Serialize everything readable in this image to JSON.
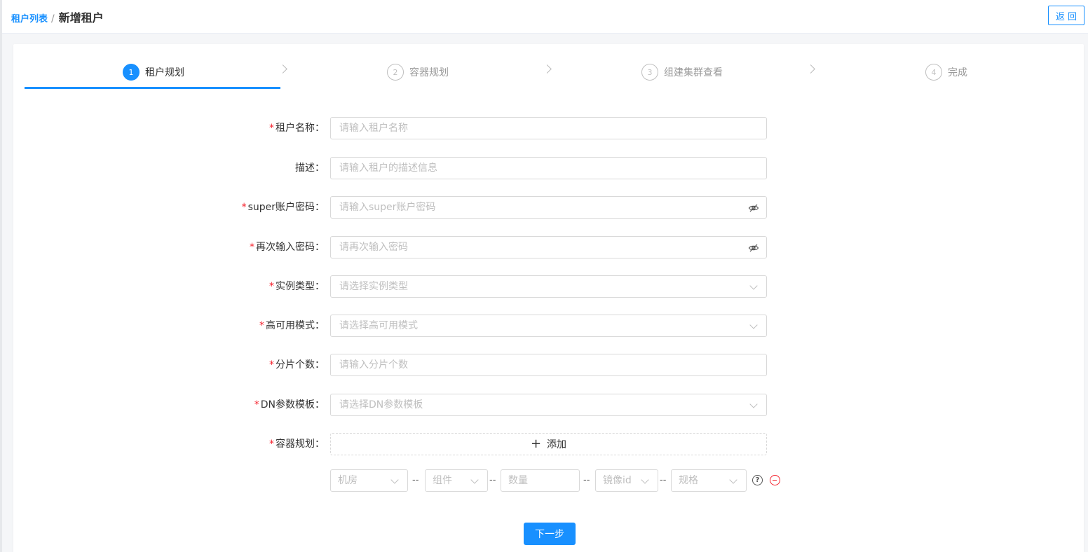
{
  "header": {
    "breadcrumb_link": "租户列表",
    "breadcrumb_sep": "/",
    "page_title": "新增租户",
    "back_label": "返 回"
  },
  "steps": [
    {
      "num": "1",
      "label": "租户规划",
      "active": true
    },
    {
      "num": "2",
      "label": "容器规划",
      "active": false
    },
    {
      "num": "3",
      "label": "组建集群查看",
      "active": false
    },
    {
      "num": "4",
      "label": "完成",
      "active": false
    }
  ],
  "form": {
    "tenant_name": {
      "label": "租户名称：",
      "required": true,
      "placeholder": "请输入租户名称"
    },
    "description": {
      "label": "描述：",
      "required": false,
      "placeholder": "请输入租户的描述信息"
    },
    "super_password": {
      "label": "super账户密码：",
      "required": true,
      "placeholder": "请输入super账户密码"
    },
    "confirm_password": {
      "label": "再次输入密码：",
      "required": true,
      "placeholder": "请再次输入密码"
    },
    "instance_type": {
      "label": "实例类型：",
      "required": true,
      "placeholder": "请选择实例类型"
    },
    "ha_mode": {
      "label": "高可用模式：",
      "required": true,
      "placeholder": "请选择高可用模式"
    },
    "shard_count": {
      "label": "分片个数：",
      "required": true,
      "placeholder": "请输入分片个数"
    },
    "dn_template": {
      "label": "DN参数模板：",
      "required": true,
      "placeholder": "请选择DN参数模板"
    },
    "container_plan": {
      "label": "容器规划：",
      "required": true,
      "add_label": "添加"
    }
  },
  "container_row": {
    "room": "机房",
    "component": "组件",
    "quantity": "数量",
    "image_id": "镜像id",
    "spec": "规格",
    "separator": "--"
  },
  "actions": {
    "next_label": "下一步"
  },
  "colors": {
    "primary": "#1890ff",
    "required": "#f5222d",
    "border": "#d9d9d9",
    "placeholder": "#bfbfbf"
  }
}
